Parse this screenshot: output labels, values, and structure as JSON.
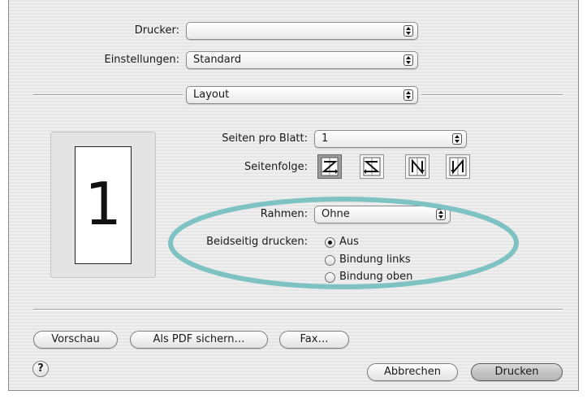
{
  "printer": {
    "label": "Drucker:",
    "value": ""
  },
  "settings": {
    "label": "Einstellungen:",
    "value": "Standard"
  },
  "panel": {
    "value": "Layout"
  },
  "preview": {
    "page_number": "1"
  },
  "pages_per_sheet": {
    "label": "Seiten pro Blatt:",
    "value": "1"
  },
  "page_order": {
    "label": "Seitenfolge:",
    "selected_index": 0
  },
  "border": {
    "label": "Rahmen:",
    "value": "Ohne"
  },
  "duplex": {
    "label": "Beidseitig drucken:",
    "options": [
      "Aus",
      "Bindung links",
      "Bindung oben"
    ],
    "selected_index": 0
  },
  "buttons": {
    "preview": "Vorschau",
    "save_pdf": "Als PDF sichern…",
    "fax": "Fax…",
    "help": "?",
    "cancel": "Abbrechen",
    "print": "Drucken"
  },
  "colors": {
    "highlight_ellipse": "#7fc2c4"
  }
}
